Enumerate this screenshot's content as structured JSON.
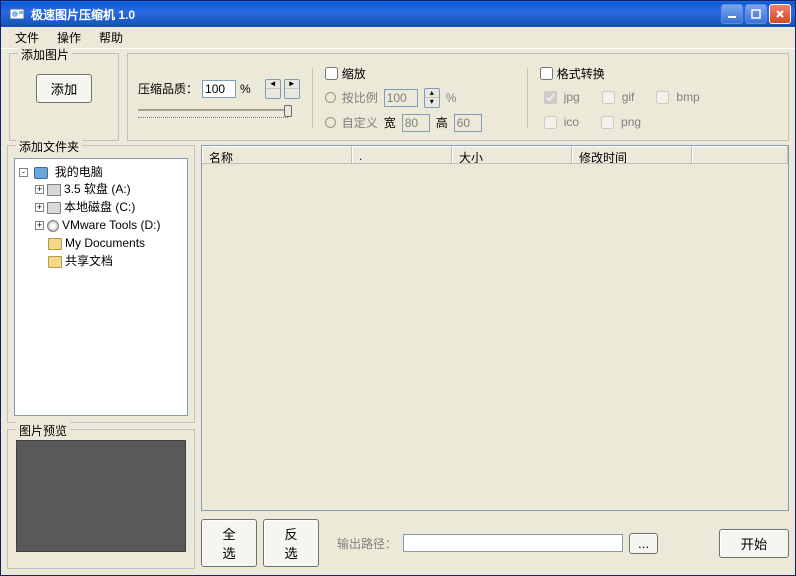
{
  "window": {
    "title": "极速图片压缩机 1.0"
  },
  "menu": {
    "file": "文件",
    "action": "操作",
    "help": "帮助"
  },
  "addGroup": {
    "legend": "添加图片",
    "button": "添加"
  },
  "quality": {
    "label": "压缩品质：",
    "value": "100",
    "percent": "%"
  },
  "scale": {
    "checkbox": "缩放",
    "radio_ratio": "按比例",
    "ratio_value": "100",
    "percent": "%",
    "radio_custom": "自定义",
    "width_label": "宽",
    "width_value": "80",
    "height_label": "高",
    "height_value": "60"
  },
  "format": {
    "checkbox": "格式转换",
    "jpg": "jpg",
    "gif": "gif",
    "bmp": "bmp",
    "ico": "ico",
    "png": "png"
  },
  "folder_group": {
    "legend": "添加文件夹"
  },
  "tree": {
    "root": "我的电脑",
    "floppy": "3.5 软盘 (A:)",
    "localc": "本地磁盘 (C:)",
    "vm": "VMware Tools (D:)",
    "mydocs": "My Documents",
    "shared": "共享文档"
  },
  "preview": {
    "legend": "图片预览"
  },
  "list": {
    "col_name": "名称",
    "col_dot": ".",
    "col_size": "大小",
    "col_mtime": "修改时间"
  },
  "bottom": {
    "select_all": "全选",
    "invert": "反选",
    "output_label": "输出路径：",
    "output_value": "",
    "browse": "...",
    "start": "开始"
  }
}
